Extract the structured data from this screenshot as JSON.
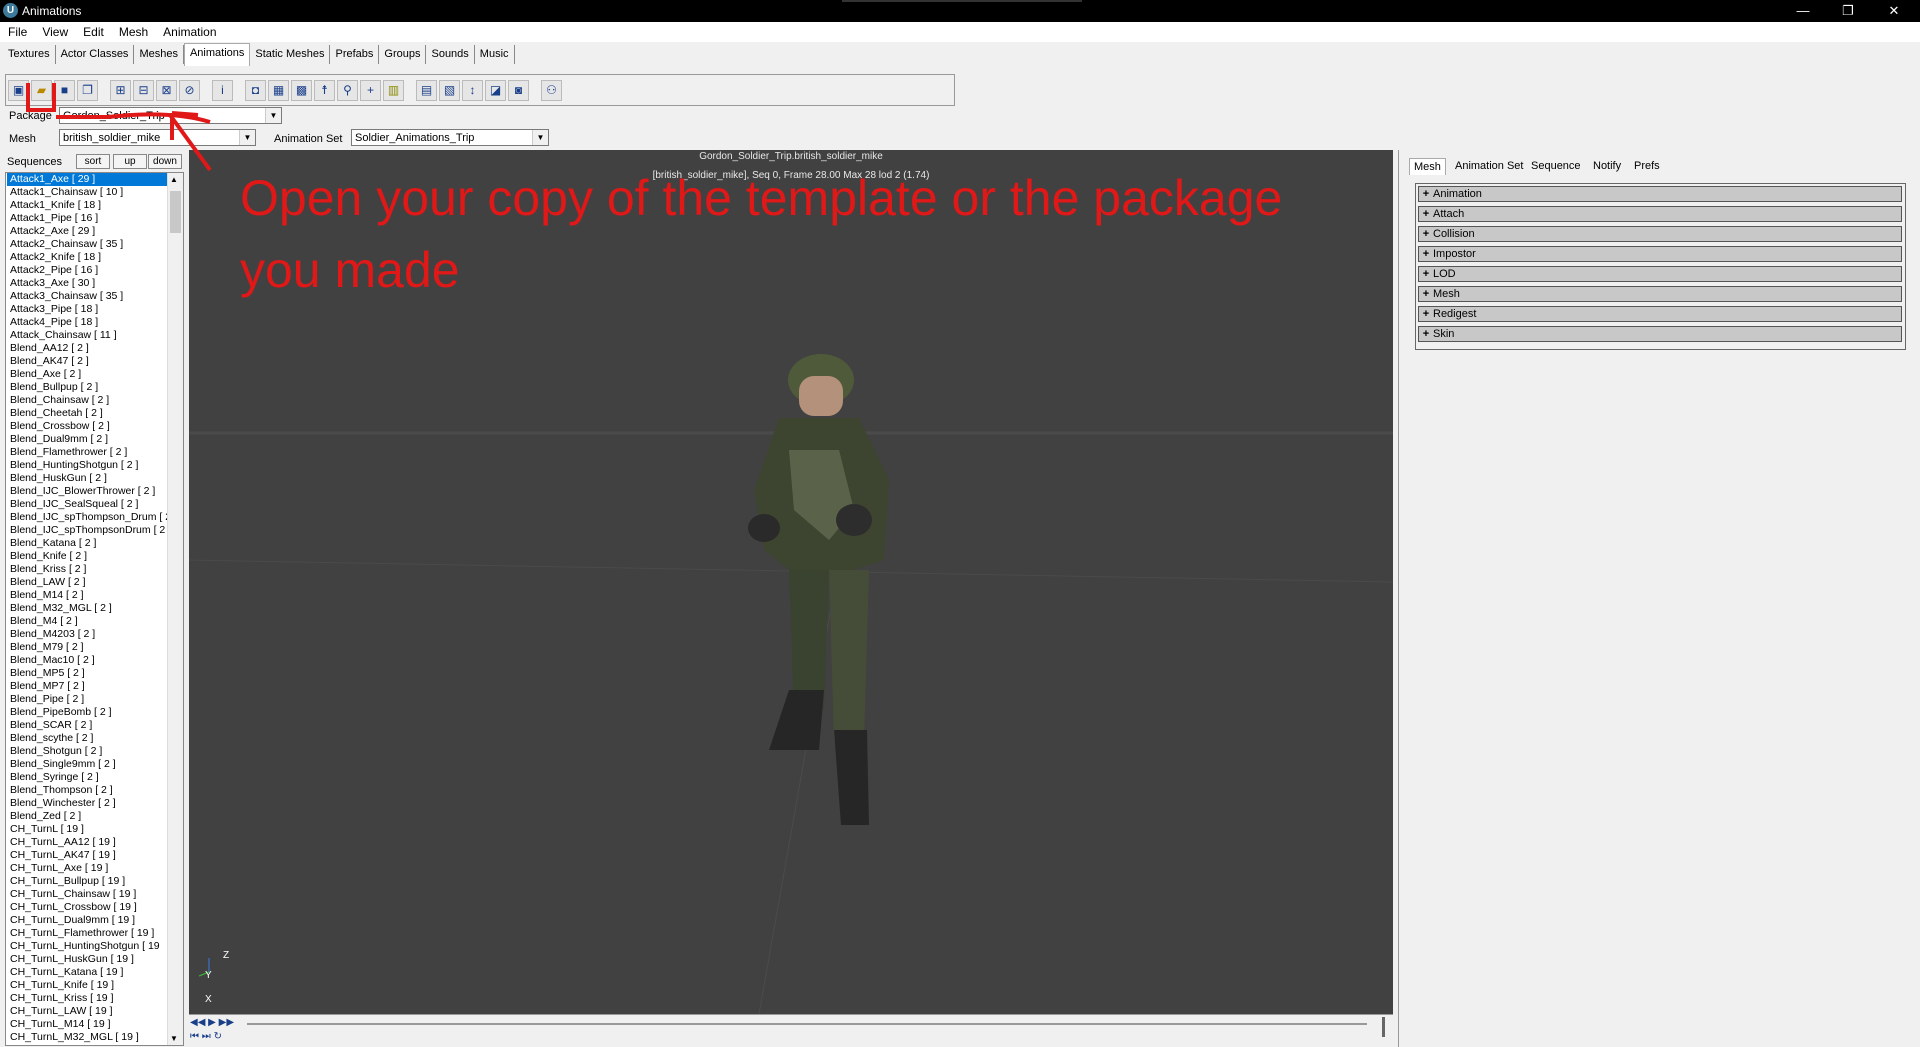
{
  "window": {
    "title": "Animations",
    "controls": [
      "—",
      "❐",
      "✕"
    ]
  },
  "menu": [
    "File",
    "View",
    "Edit",
    "Mesh",
    "Animation"
  ],
  "browser_tabs": [
    "Textures",
    "Actor Classes",
    "Meshes",
    "Animations",
    "Static Meshes",
    "Prefabs",
    "Groups",
    "Sounds",
    "Music"
  ],
  "active_tab": "Animations",
  "fields": {
    "package_label": "Package",
    "package_value": "Gordon_Soldier_Trip",
    "mesh_label": "Mesh",
    "mesh_value": "british_soldier_mike",
    "animset_label": "Animation Set",
    "animset_value": "Soldier_Animations_Trip"
  },
  "sequences": {
    "label": "Sequences",
    "buttons": [
      "sort",
      "up",
      "down"
    ],
    "selected": "Attack1_Axe [ 29 ]",
    "items": [
      "Attack1_Axe [ 29 ]",
      "Attack1_Chainsaw [ 10 ]",
      "Attack1_Knife [ 18 ]",
      "Attack1_Pipe [ 16 ]",
      "Attack2_Axe [ 29 ]",
      "Attack2_Chainsaw [ 35 ]",
      "Attack2_Knife [ 18 ]",
      "Attack2_Pipe [ 16 ]",
      "Attack3_Axe [ 30 ]",
      "Attack3_Chainsaw [ 35 ]",
      "Attack3_Pipe [ 18 ]",
      "Attack4_Pipe [ 18 ]",
      "Attack_Chainsaw [ 11 ]",
      "Blend_AA12 [ 2 ]",
      "Blend_AK47 [ 2 ]",
      "Blend_Axe [ 2 ]",
      "Blend_Bullpup [ 2 ]",
      "Blend_Chainsaw [ 2 ]",
      "Blend_Cheetah [ 2 ]",
      "Blend_Crossbow [ 2 ]",
      "Blend_Dual9mm [ 2 ]",
      "Blend_Flamethrower [ 2 ]",
      "Blend_HuntingShotgun [ 2 ]",
      "Blend_HuskGun [ 2 ]",
      "Blend_IJC_BlowerThrower [ 2 ]",
      "Blend_IJC_SealSqueal [ 2 ]",
      "Blend_IJC_spThompson_Drum [ 2",
      "Blend_IJC_spThompsonDrum [ 2",
      "Blend_Katana [ 2 ]",
      "Blend_Knife [ 2 ]",
      "Blend_Kriss [ 2 ]",
      "Blend_LAW [ 2 ]",
      "Blend_M14 [ 2 ]",
      "Blend_M32_MGL [ 2 ]",
      "Blend_M4 [ 2 ]",
      "Blend_M4203 [ 2 ]",
      "Blend_M79 [ 2 ]",
      "Blend_Mac10 [ 2 ]",
      "Blend_MP5 [ 2 ]",
      "Blend_MP7 [ 2 ]",
      "Blend_Pipe [ 2 ]",
      "Blend_PipeBomb [ 2 ]",
      "Blend_SCAR [ 2 ]",
      "Blend_scythe [ 2 ]",
      "Blend_Shotgun [ 2 ]",
      "Blend_Single9mm [ 2 ]",
      "Blend_Syringe [ 2 ]",
      "Blend_Thompson [ 2 ]",
      "Blend_Winchester [ 2 ]",
      "Blend_Zed [ 2 ]",
      "CH_TurnL [ 19 ]",
      "CH_TurnL_AA12 [ 19 ]",
      "CH_TurnL_AK47 [ 19 ]",
      "CH_TurnL_Axe [ 19 ]",
      "CH_TurnL_Bullpup [ 19 ]",
      "CH_TurnL_Chainsaw [ 19 ]",
      "CH_TurnL_Crossbow [ 19 ]",
      "CH_TurnL_Dual9mm [ 19 ]",
      "CH_TurnL_Flamethrower [ 19 ]",
      "CH_TurnL_HuntingShotgun [ 19",
      "CH_TurnL_HuskGun [ 19 ]",
      "CH_TurnL_Katana [ 19 ]",
      "CH_TurnL_Knife [ 19 ]",
      "CH_TurnL_Kriss [ 19 ]",
      "CH_TurnL_LAW [ 19 ]",
      "CH_TurnL_M14 [ 19 ]",
      "CH_TurnL_M32_MGL [ 19 ]"
    ]
  },
  "viewport": {
    "object_name": "Gordon_Soldier_Trip.british_soldier_mike",
    "status": "[british_soldier_mike], Seq 0,  Frame 28.00 Max 28  lod 2 (1.74)",
    "axis_z": "Z",
    "axis_y": "Y",
    "axis_x": "X",
    "bg_color": "#414141"
  },
  "properties": {
    "tabs": [
      "Mesh",
      "Animation Set",
      "Sequence",
      "Notify",
      "Prefs"
    ],
    "active_tab": "Mesh",
    "groups": [
      "Animation",
      "Attach",
      "Collision",
      "Impostor",
      "LOD",
      "Mesh",
      "Redigest",
      "Skin"
    ]
  },
  "annotation": {
    "line1": "Open your copy of the template or the package",
    "line2": "you made",
    "color": "#e01818"
  },
  "toolbar_icons": [
    "new-package-icon",
    "open-package-icon",
    "save-package-icon",
    "duplicate-icon",
    "import-mesh-icon",
    "import-anim-icon",
    "export-icon",
    "link-icon",
    "info-icon",
    "view-mesh-icon",
    "wireframe-icon",
    "bounding-icon",
    "skeleton-icon",
    "bone-names-icon",
    "pivot-icon",
    "tangents-icon",
    "render-icon",
    "lod-icon",
    "anim-notify-icon",
    "compress-icon",
    "digest-icon",
    "actor-icon"
  ]
}
